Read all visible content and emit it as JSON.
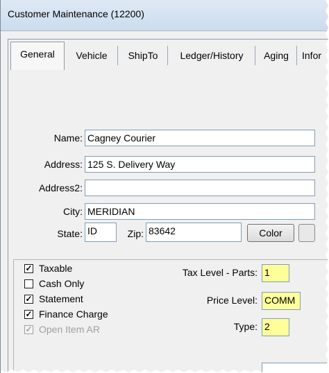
{
  "window": {
    "title": "Customer Maintenance (12200)"
  },
  "tabs": [
    {
      "label": "General"
    },
    {
      "label": "Vehicle"
    },
    {
      "label": "ShipTo"
    },
    {
      "label": "Ledger/History"
    },
    {
      "label": "Aging"
    },
    {
      "label": "Infor"
    }
  ],
  "form": {
    "name_label": "Name:",
    "name_value": "Cagney Courier",
    "address_label": "Address:",
    "address_value": "125 S. Delivery Way",
    "address2_label": "Address2:",
    "address2_value": "",
    "city_label": "City:",
    "city_value": "MERIDIAN",
    "state_label": "State:",
    "state_value": "ID",
    "zip_label": "Zip:",
    "zip_value": "83642",
    "color_button": "Color"
  },
  "options": {
    "checkboxes": [
      {
        "label": "Taxable",
        "checked": true,
        "enabled": true
      },
      {
        "label": "Cash Only",
        "checked": false,
        "enabled": true
      },
      {
        "label": "Statement",
        "checked": true,
        "enabled": true
      },
      {
        "label": "Finance Charge",
        "checked": true,
        "enabled": true
      },
      {
        "label": "Open Item AR",
        "checked": true,
        "enabled": false
      }
    ],
    "tax_level_label": "Tax Level - Parts:",
    "tax_level_value": "1",
    "price_level_label": "Price Level:",
    "price_level_value": "COMM",
    "type_label": "Type:",
    "type_value": "2"
  },
  "colors": {
    "highlight_field": "#ffff99",
    "titlebar": "#cbdcee"
  }
}
